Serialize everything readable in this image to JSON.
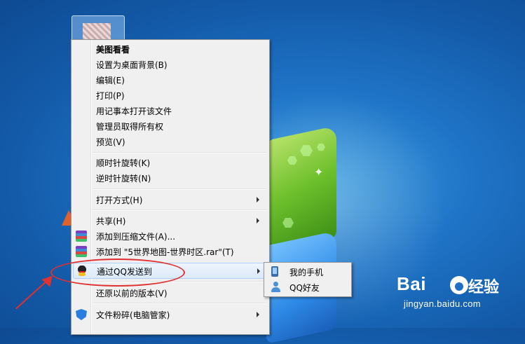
{
  "menu": {
    "items": [
      {
        "label": "美图看看"
      },
      {
        "label": "设置为桌面背景(B)"
      },
      {
        "label": "编辑(E)"
      },
      {
        "label": "打印(P)"
      },
      {
        "label": "用记事本打开该文件"
      },
      {
        "label": "管理员取得所有权"
      },
      {
        "label": "预览(V)"
      },
      {
        "label": "顺时针旋转(K)"
      },
      {
        "label": "逆时针旋转(N)"
      },
      {
        "label": "打开方式(H)"
      },
      {
        "label": "共享(H)"
      },
      {
        "label": "添加到压缩文件(A)..."
      },
      {
        "label": "添加到 \"5世界地图-世界时区.rar\"(T)"
      },
      {
        "label": "通过QQ发送到"
      },
      {
        "label": "还原以前的版本(V)"
      },
      {
        "label": "文件粉碎(电脑管家)"
      }
    ]
  },
  "submenu": {
    "items": [
      {
        "label": "我的手机"
      },
      {
        "label": "QQ好友"
      }
    ]
  },
  "watermark": {
    "logo_text": "Bai",
    "logo_cn": "经验",
    "url": "jingyan.baidu.com"
  },
  "icons": {
    "winrar": "winrar-icon",
    "qq": "qq-penguin-icon",
    "shield": "tencent-pc-manager-shield-icon",
    "phone": "phone-icon",
    "friend": "person-icon"
  },
  "colors": {
    "annotation": "#e03030",
    "menu_bg": "#f0f0f0",
    "hover_border": "#aecff7"
  }
}
